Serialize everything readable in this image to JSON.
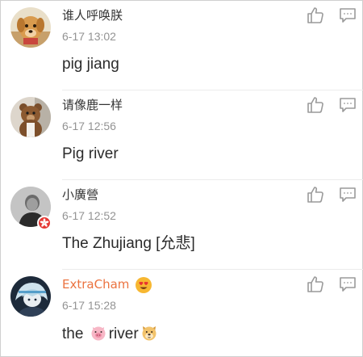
{
  "comments": [
    {
      "username": "谁人呼唤朕",
      "time": "6-17 13:02",
      "text": "pig jiang",
      "avatar_icon": "dog-avatar-icon"
    },
    {
      "username": "请像鹿一样",
      "time": "6-17 12:56",
      "text": "Pig river",
      "avatar_icon": "bear-avatar-icon"
    },
    {
      "username": "小廣營",
      "time": "6-17 12:52",
      "text": "The Zhujiang [允悲]",
      "avatar_icon": "person-avatar-icon"
    },
    {
      "username": "ExtraCham",
      "time": "6-17 15:28",
      "text_before": "the",
      "text_middle": "river",
      "avatar_icon": "anime-avatar-icon",
      "username_color": "#eb7340"
    }
  ],
  "icons": {
    "like": "thumbs-up-icon",
    "reply": "comment-bubble-icon",
    "verified_badge": "hongkong-badge-icon",
    "name_emoji": "heart-eyes-emoji-icon",
    "inline_emoji_1": "pig-emoji-icon",
    "inline_emoji_2": "doge-emoji-icon"
  },
  "colors": {
    "icon_gray": "#9a9a9a",
    "divider": "#ececec",
    "time": "#939393",
    "text": "#2b2b2b",
    "vip_name": "#eb7340",
    "badge": "#e53935"
  }
}
